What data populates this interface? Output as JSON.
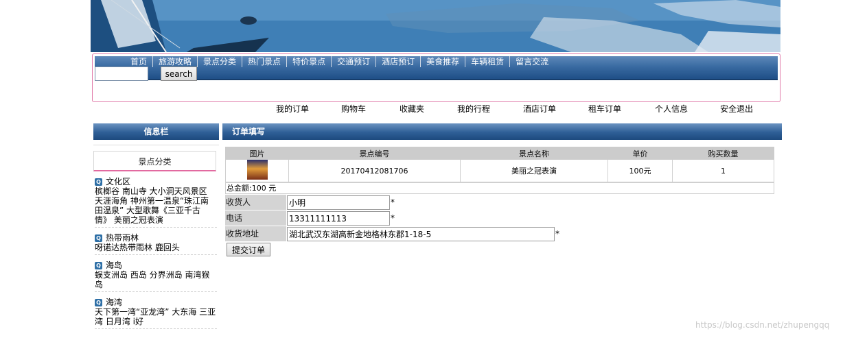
{
  "nav": {
    "items": [
      "首页",
      "旅游攻略",
      "景点分类",
      "热门景点",
      "特价景点",
      "交通预订",
      "酒店预订",
      "美食推荐",
      "车辆租赁",
      "留言交流"
    ],
    "search_value": "",
    "search_button": "search"
  },
  "user_menu": [
    "我的订单",
    "购物车",
    "收藏夹",
    "我的行程",
    "酒店订单",
    "租车订单",
    "个人信息",
    "安全退出"
  ],
  "sidebar": {
    "title": "信息栏",
    "subtitle": "景点分类",
    "regions": [
      {
        "name": "文化区",
        "spots": "槟榔谷  南山寺  大小洞天风景区  天涯海角  神州第一温泉“珠江南田温泉”  大型歌舞《三亚千古情》  美丽之冠表演"
      },
      {
        "name": "热带雨林",
        "spots": "呀诺达热带雨林  鹿回头"
      },
      {
        "name": "海岛",
        "spots": "蜈支洲岛  西岛  分界洲岛  南湾猴岛"
      },
      {
        "name": "海湾",
        "spots": "天下第一湾“亚龙湾”  大东海  三亚湾  日月湾  i好"
      }
    ]
  },
  "main": {
    "title": "订单填写",
    "table": {
      "headers": [
        "图片",
        "景点编号",
        "景点名称",
        "单价",
        "购买数量"
      ],
      "rows": [
        {
          "id": "20170412081706",
          "name": "美丽之冠表演",
          "price": "100元",
          "qty": "1"
        }
      ]
    },
    "total": "总金额:100  元",
    "form": {
      "receiver_label": "收货人",
      "receiver_value": "小明",
      "phone_label": "电话",
      "phone_value": "13311111113",
      "address_label": "收货地址",
      "address_value": "湖北武汉东湖高新金地格林东郡1-18-5",
      "required_mark": "*",
      "submit": "提交订单"
    }
  },
  "watermark": "https://blog.csdn.net/zhupengqq",
  "colors": {
    "nav_blue": "#2e5e96",
    "pink_border": "#e07aa8",
    "header_gray": "#cccccc"
  }
}
